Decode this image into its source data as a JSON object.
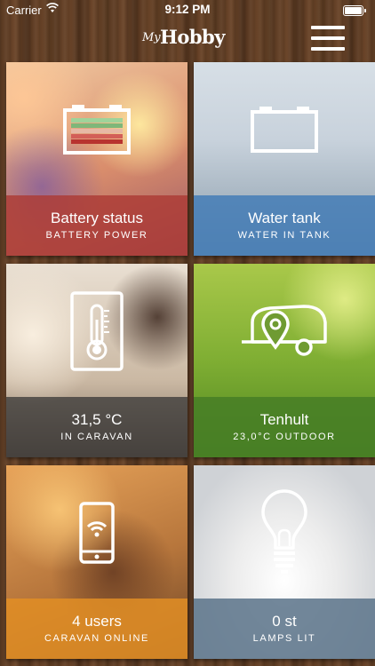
{
  "status_bar": {
    "carrier": "Carrier",
    "time": "9:12 PM",
    "wifi_icon": "wifi-icon",
    "battery_icon": "battery-icon"
  },
  "header": {
    "logo_prefix": "My",
    "logo_main": "Hobby",
    "menu_icon": "hamburger-menu-icon"
  },
  "tiles": [
    {
      "title": "Battery status",
      "subtitle": "BATTERY POWER",
      "icon": "battery-icon",
      "band_color": "#ac3a34"
    },
    {
      "title": "Water tank",
      "subtitle": "WATER IN TANK",
      "icon": "water-tank-icon",
      "band_color": "#447db6"
    },
    {
      "title": "31,5 °C",
      "subtitle": "IN CARAVAN",
      "icon": "thermometer-icon",
      "band_color": "#323232"
    },
    {
      "title": "Tenhult",
      "subtitle": "23,0°C OUTDOOR",
      "icon": "caravan-location-icon",
      "band_color": "#467e26"
    },
    {
      "title": "4 users",
      "subtitle": "CARAVAN ONLINE",
      "icon": "phone-wifi-icon",
      "band_color": "#e28e24"
    },
    {
      "title": "0 st",
      "subtitle": "LAMPS LIT",
      "icon": "light-bulb-icon",
      "band_color": "#5f768c"
    }
  ]
}
